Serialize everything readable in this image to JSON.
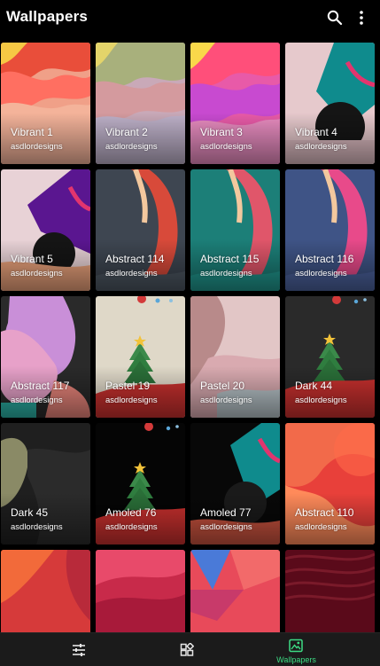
{
  "app": {
    "title": "Wallpapers",
    "accent": "#3ddc84",
    "icons": [
      "search-icon",
      "more-vert-icon"
    ]
  },
  "wallpapers": [
    {
      "name": "Vibrant 1",
      "author": "asdlordesigns"
    },
    {
      "name": "Vibrant 2",
      "author": "asdlordesigns"
    },
    {
      "name": "Vibrant 3",
      "author": "asdlordesigns"
    },
    {
      "name": "Vibrant 4",
      "author": "asdlordesigns"
    },
    {
      "name": "Vibrant 5",
      "author": "asdlordesigns"
    },
    {
      "name": "Abstract 114",
      "author": "asdlordesigns"
    },
    {
      "name": "Abstract 115",
      "author": "asdlordesigns"
    },
    {
      "name": "Abstract 116",
      "author": "asdlordesigns"
    },
    {
      "name": "Abstract 117",
      "author": "asdlordesigns"
    },
    {
      "name": "Pastel 19",
      "author": "asdlordesigns"
    },
    {
      "name": "Pastel 20",
      "author": "asdlordesigns"
    },
    {
      "name": "Dark 44",
      "author": "asdlordesigns"
    },
    {
      "name": "Dark 45",
      "author": "asdlordesigns"
    },
    {
      "name": "Amoled 76",
      "author": "asdlordesigns"
    },
    {
      "name": "Amoled 77",
      "author": "asdlordesigns"
    },
    {
      "name": "Abstract 110",
      "author": "asdlordesigns"
    },
    {
      "name": "",
      "author": ""
    },
    {
      "name": "",
      "author": ""
    },
    {
      "name": "",
      "author": ""
    },
    {
      "name": "",
      "author": ""
    }
  ],
  "bottom_nav": [
    {
      "icon": "tune-icon",
      "label": "",
      "active": false
    },
    {
      "icon": "widgets-icon",
      "label": "",
      "active": false
    },
    {
      "icon": "wallpaper-icon",
      "label": "Wallpapers",
      "active": true
    }
  ]
}
